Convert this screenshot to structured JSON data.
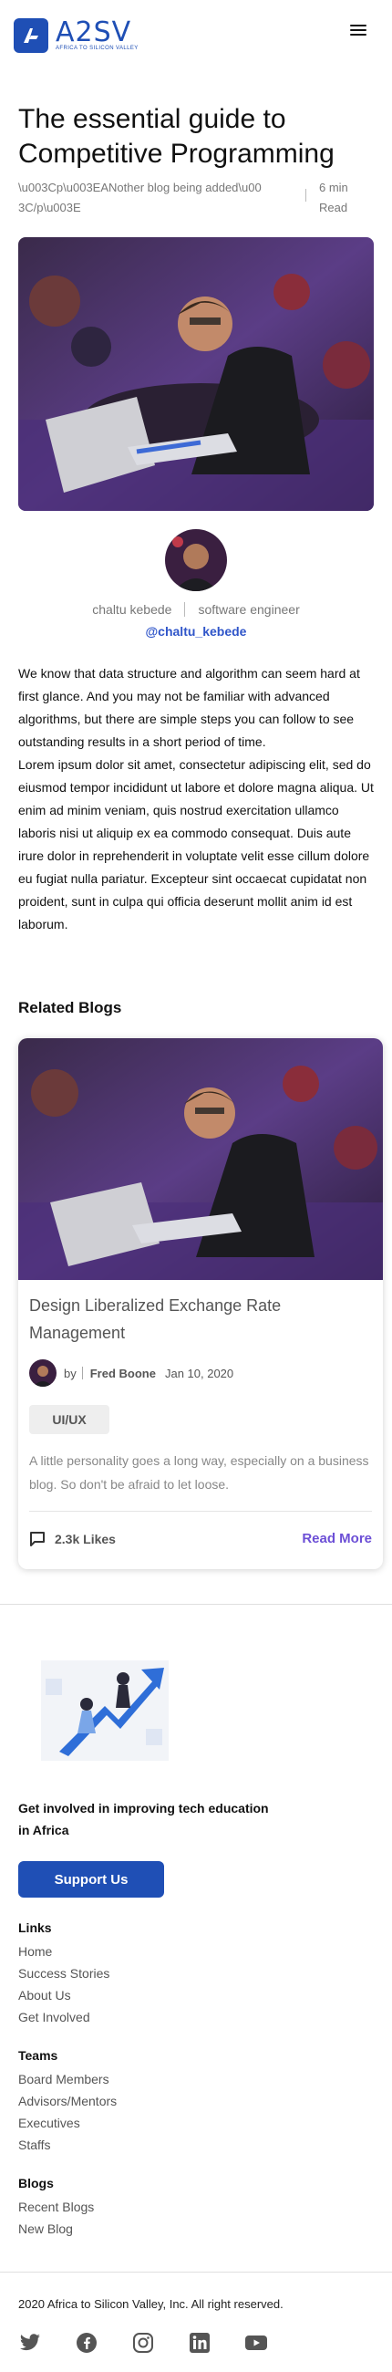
{
  "header": {
    "logo_text": "A2SV",
    "logo_subtitle": "AFRICA TO SILICON VALLEY",
    "brand_color": "#1f4fb5"
  },
  "article": {
    "title": "The essential guide to Competitive Programming",
    "description": "\\u003Cp\\u003EANother blog being added\\u003C/p\\u003E",
    "read_time": "6 min Read",
    "author_name": "chaltu kebede",
    "author_role": "software engineer",
    "author_handle": "@chaltu_kebede",
    "paragraphs": [
      "We know that data structure and algorithm can seem hard at first glance. And you may not be familiar with advanced algorithms, but there are simple steps you can follow to see outstanding results in a short period of time.",
      "Lorem ipsum dolor sit amet, consectetur adipiscing elit, sed do eiusmod tempor incididunt ut labore et dolore magna aliqua. Ut enim ad minim veniam, quis nostrud exercitation ullamco laboris nisi ut aliquip ex ea commodo consequat. Duis aute irure dolor in reprehenderit in voluptate velit esse cillum dolore eu fugiat nulla pariatur. Excepteur sint occaecat cupidatat non proident, sunt in culpa qui officia deserunt mollit anim id est laborum."
    ]
  },
  "related": {
    "heading": "Related Blogs",
    "card": {
      "title": "Design Liberalized Exchange Rate Management",
      "by": "by",
      "author": "Fred Boone",
      "date": "Jan 10, 2020",
      "tag": "UI/UX",
      "excerpt": "A little personality goes a long way, especially on a business blog. So don't be afraid to let loose.",
      "likes": "2.3k Likes",
      "read_more": "Read More",
      "accent": "#6c4fd6"
    }
  },
  "footer": {
    "tagline": "Get involved in improving tech education in Africa",
    "support_button": "Support Us",
    "links": {
      "heading": "Links",
      "items": [
        "Home",
        "Success Stories",
        "About Us",
        "Get Involved"
      ]
    },
    "teams": {
      "heading": "Teams",
      "items": [
        "Board Members",
        "Advisors/Mentors",
        "Executives",
        "Staffs"
      ]
    },
    "blogs": {
      "heading": "Blogs",
      "items": [
        "Recent Blogs",
        "New Blog"
      ]
    },
    "copyright": "2020 Africa to Silicon Valley, Inc. All right reserved.",
    "socials": [
      "twitter-icon",
      "facebook-icon",
      "instagram-icon",
      "linkedin-icon",
      "youtube-icon"
    ]
  }
}
